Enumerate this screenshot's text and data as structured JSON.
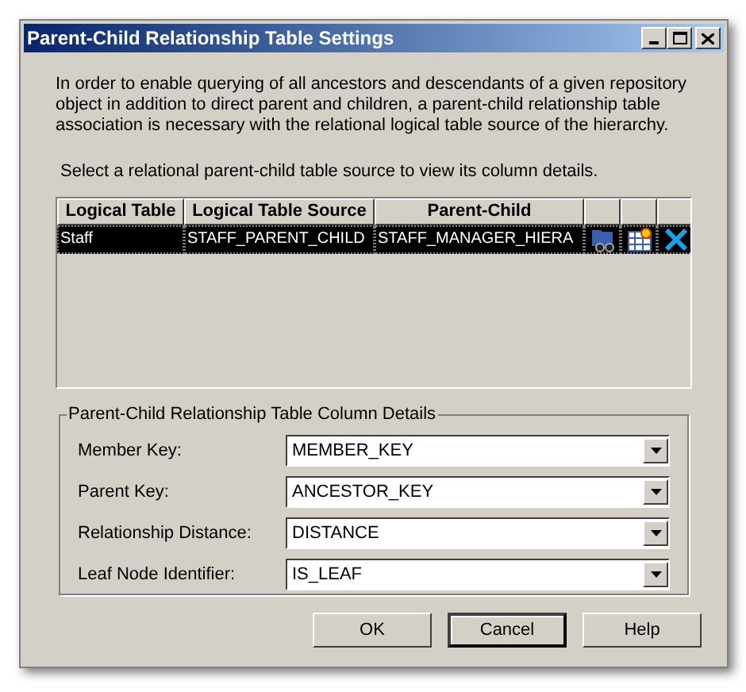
{
  "window": {
    "title": "Parent-Child Relationship Table Settings"
  },
  "description": "In order to enable querying of all ancestors and descendants of a given repository object in addition to direct parent and children, a parent-child relationship table association is necessary with the relational logical table source of the hierarchy.",
  "instruction": "Select a relational parent-child table source to view its column details.",
  "table": {
    "columns": [
      "Logical Table",
      "Logical Table Source",
      "Parent-Child"
    ],
    "rows": [
      {
        "cells": [
          "Staff",
          "STAFF_PARENT_CHILD",
          "STAFF_MANAGER_HIERA"
        ],
        "selected": true
      }
    ]
  },
  "details": {
    "title": "Parent-Child Relationship Table Column Details",
    "fields": [
      {
        "label": "Member Key:",
        "value": "MEMBER_KEY"
      },
      {
        "label": "Parent Key:",
        "value": "ANCESTOR_KEY"
      },
      {
        "label": "Relationship Distance:",
        "value": "DISTANCE"
      },
      {
        "label": "Leaf Node Identifier:",
        "value": "IS_LEAF"
      }
    ]
  },
  "buttons": [
    {
      "label": "OK",
      "default": false
    },
    {
      "label": "Cancel",
      "default": true
    },
    {
      "label": "Help",
      "default": false
    }
  ]
}
